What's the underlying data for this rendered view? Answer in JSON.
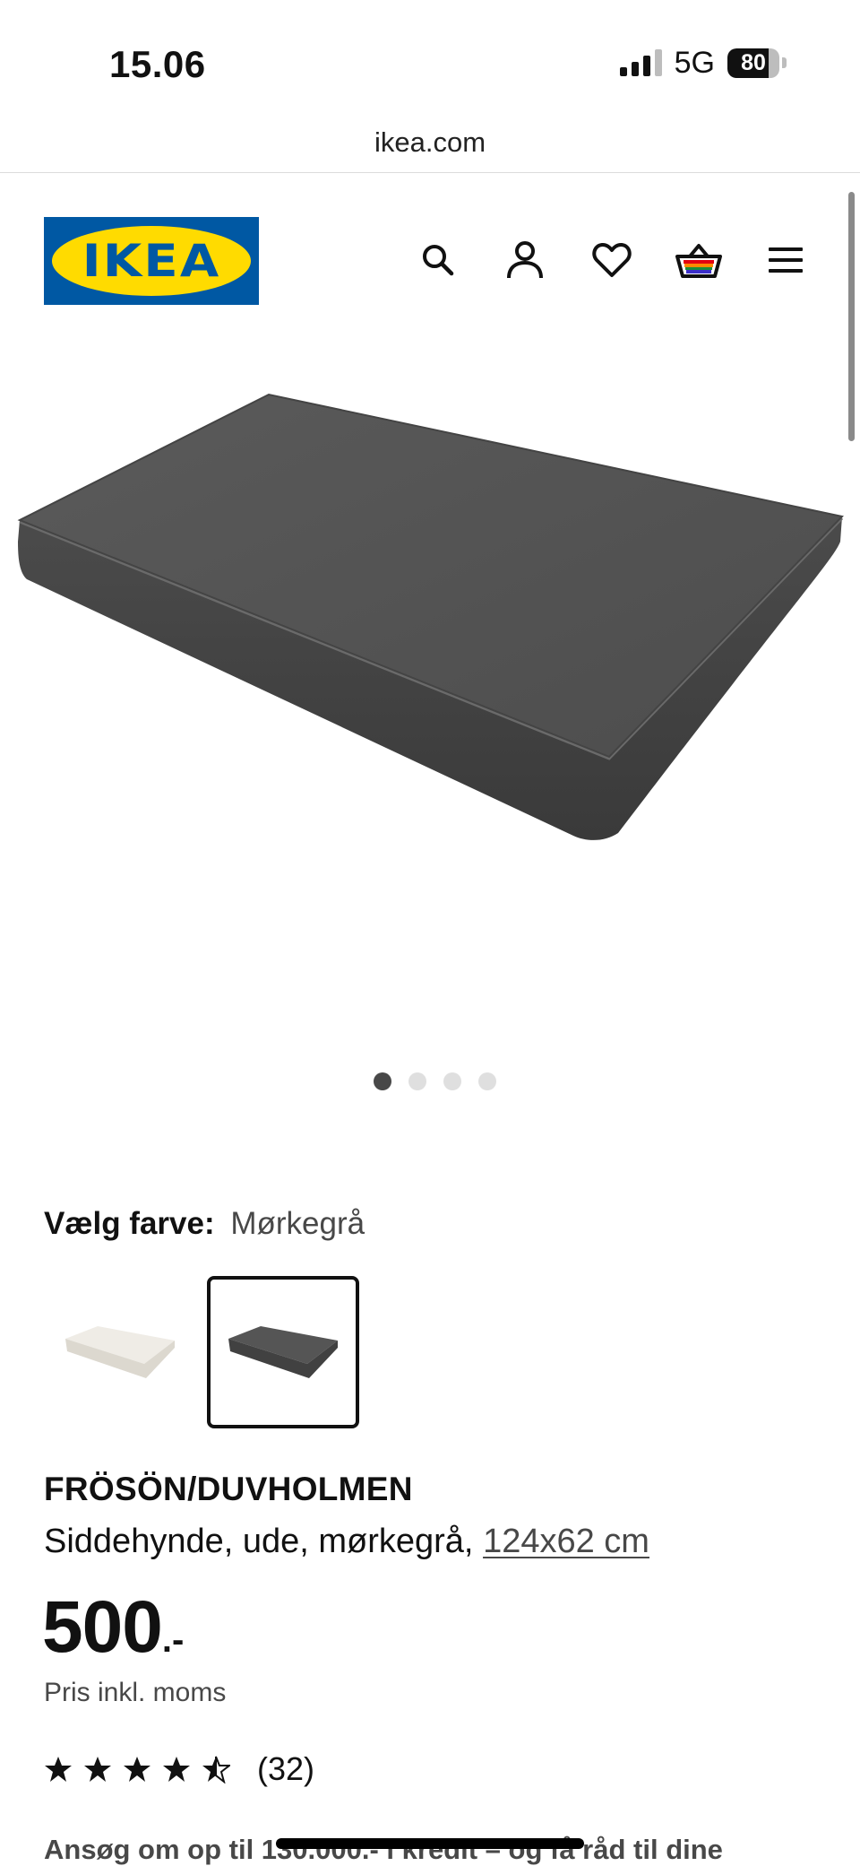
{
  "status_bar": {
    "time": "15.06",
    "network": "5G",
    "battery_percent": "80",
    "battery_level": 0.8,
    "signal_bars": 3
  },
  "browser": {
    "url": "ikea.com"
  },
  "header": {
    "logo_text": "IKEA",
    "logo_colors": {
      "blue": "#0058a3",
      "yellow": "#ffdb00"
    },
    "icons": [
      "search-icon",
      "profile-icon",
      "heart-icon",
      "basket-icon",
      "menu-icon"
    ]
  },
  "gallery": {
    "image_count": 4,
    "active_index": 0
  },
  "color_select": {
    "label": "Vælg farve:",
    "value": "Mørkegrå",
    "swatches": [
      {
        "name": "beige",
        "color": "#e8e4dc",
        "selected": false
      },
      {
        "name": "dark-grey",
        "color": "#4a4a4a",
        "selected": true
      }
    ]
  },
  "product": {
    "name": "FRÖSÖN/DUVHOLMEN",
    "description": "Siddehynde, ude, mørkegrå, ",
    "size_link": "124x62 cm",
    "price": "500",
    "price_suffix": ".-",
    "price_note": "Pris inkl. moms",
    "rating": 4.5,
    "review_count": "(32)"
  },
  "promo": {
    "credit_text": "Ansøg om op til 130.000.- i kredit – og få råd til dine"
  }
}
